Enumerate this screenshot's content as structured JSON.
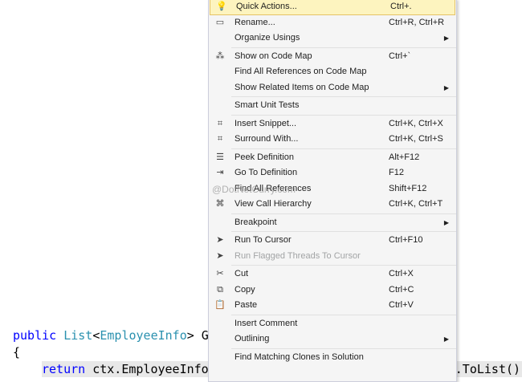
{
  "code": {
    "line1": {
      "kw": "public",
      "type1": "List",
      "lt": "<",
      "type2": "EmployeeInfo",
      "rest": "> Ge"
    },
    "line2": "{",
    "line3": {
      "kw": "return",
      "rest": " ctx.EmployeeInfoes.Where(d => d.DeptName == dname).ToList();"
    }
  },
  "menu": {
    "groups": [
      [
        {
          "icon": "lightbulb-icon",
          "glyph": "💡",
          "label": "Quick Actions...",
          "shortcut": "Ctrl+.",
          "highlighted": true
        },
        {
          "icon": "rename-icon",
          "glyph": "▭",
          "label": "Rename...",
          "shortcut": "Ctrl+R, Ctrl+R"
        },
        {
          "label": "Organize Usings",
          "submenu": true
        }
      ],
      [
        {
          "icon": "code-map-icon",
          "glyph": "⁂",
          "label": "Show on Code Map",
          "shortcut": "Ctrl+`"
        },
        {
          "label": "Find All References on Code Map"
        },
        {
          "label": "Show Related Items on Code Map",
          "submenu": true
        }
      ],
      [
        {
          "label": "Smart Unit Tests"
        }
      ],
      [
        {
          "icon": "insert-snippet-icon",
          "glyph": "⌗",
          "label": "Insert Snippet...",
          "shortcut": "Ctrl+K, Ctrl+X"
        },
        {
          "icon": "surround-with-icon",
          "glyph": "⌗",
          "label": "Surround With...",
          "shortcut": "Ctrl+K, Ctrl+S"
        }
      ],
      [
        {
          "icon": "peek-definition-icon",
          "glyph": "☰",
          "label": "Peek Definition",
          "shortcut": "Alt+F12"
        },
        {
          "icon": "go-to-definition-icon",
          "glyph": "⇥",
          "label": "Go To Definition",
          "shortcut": "F12"
        },
        {
          "label": "Find All References",
          "shortcut": "Shift+F12"
        },
        {
          "icon": "call-hierarchy-icon",
          "glyph": "⌘",
          "label": "View Call Hierarchy",
          "shortcut": "Ctrl+K, Ctrl+T"
        }
      ],
      [
        {
          "label": "Breakpoint",
          "submenu": true
        }
      ],
      [
        {
          "icon": "run-to-cursor-icon",
          "glyph": "➤",
          "label": "Run To Cursor",
          "shortcut": "Ctrl+F10"
        },
        {
          "icon": "run-flagged-threads-icon",
          "glyph": "➤",
          "label": "Run Flagged Threads To Cursor",
          "disabled": true
        }
      ],
      [
        {
          "icon": "cut-icon",
          "glyph": "✂",
          "label": "Cut",
          "shortcut": "Ctrl+X"
        },
        {
          "icon": "copy-icon",
          "glyph": "⧉",
          "label": "Copy",
          "shortcut": "Ctrl+C"
        },
        {
          "icon": "paste-icon",
          "glyph": "📋",
          "label": "Paste",
          "shortcut": "Ctrl+V"
        }
      ],
      [
        {
          "label": "Insert Comment"
        },
        {
          "label": "Outlining",
          "submenu": true
        }
      ],
      [
        {
          "label": "Find Matching Clones in Solution"
        }
      ]
    ],
    "submenu_glyph": "▶"
  },
  "watermark": "@DotNetCurry.com"
}
